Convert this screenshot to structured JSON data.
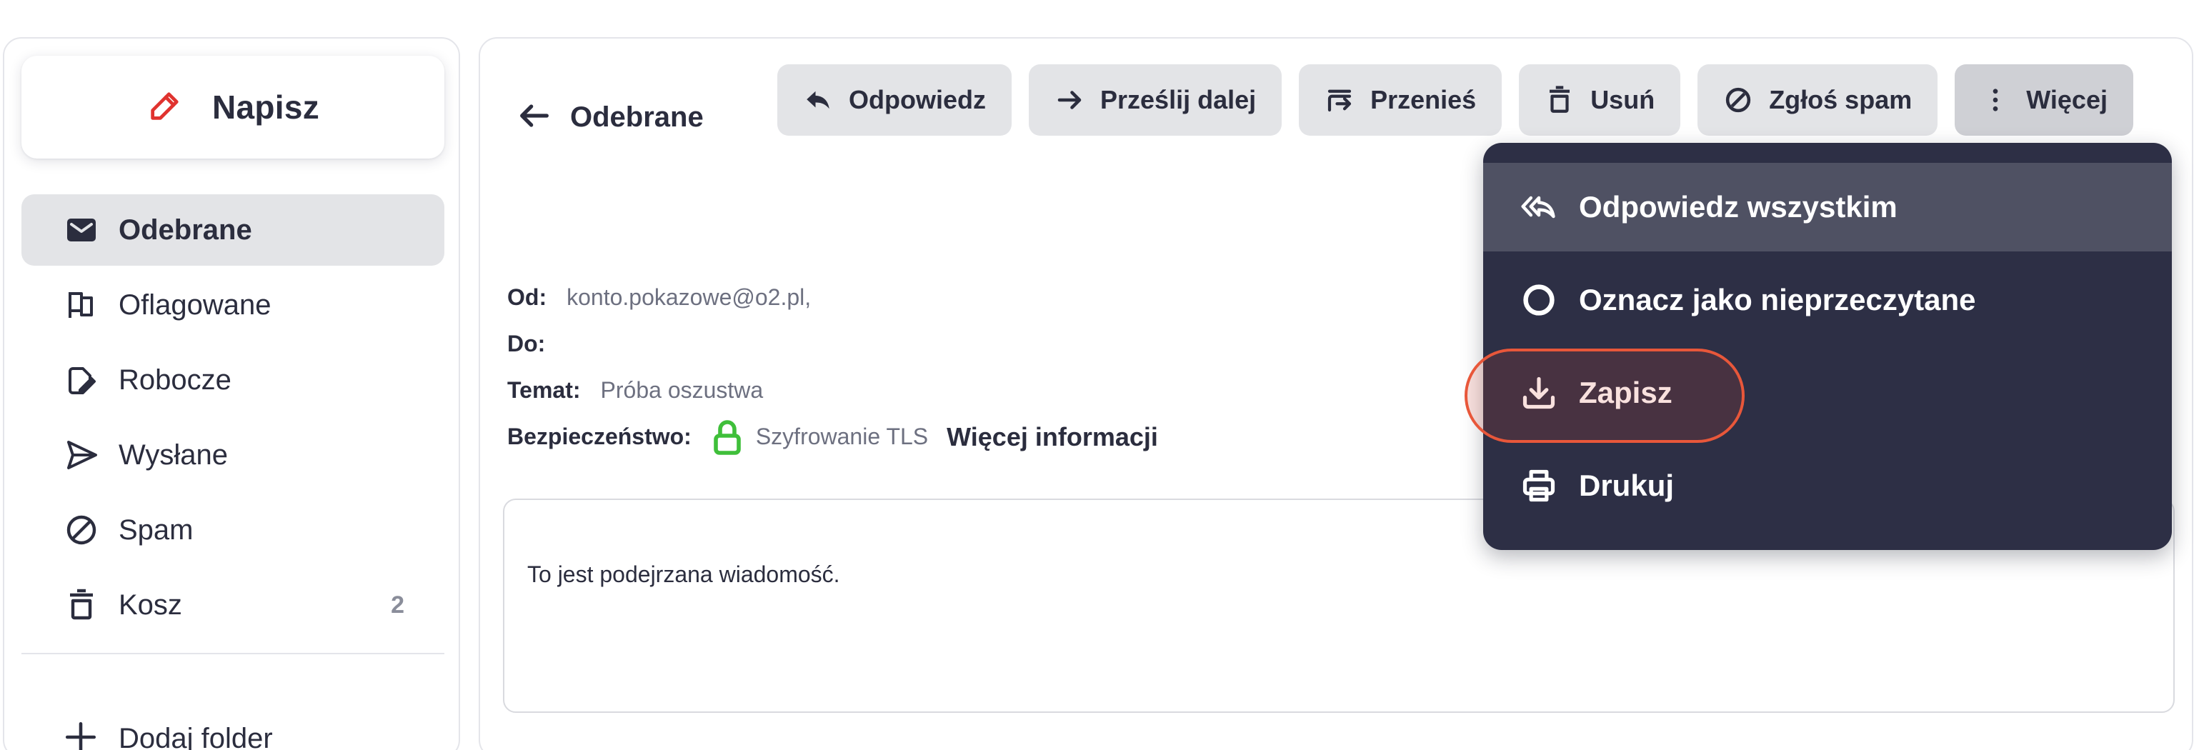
{
  "sidebar": {
    "compose_label": "Napisz",
    "folders": [
      {
        "label": "Odebrane",
        "icon": "envelope-icon",
        "active": true
      },
      {
        "label": "Oflagowane",
        "icon": "flag-icon"
      },
      {
        "label": "Robocze",
        "icon": "draft-icon"
      },
      {
        "label": "Wysłane",
        "icon": "send-icon"
      },
      {
        "label": "Spam",
        "icon": "block-icon"
      },
      {
        "label": "Kosz",
        "icon": "trash-icon",
        "count": "2"
      }
    ],
    "add_folder_label": "Dodaj folder"
  },
  "main": {
    "back_label": "Odebrane",
    "toolbar": {
      "reply": "Odpowiedz",
      "forward": "Prześlij dalej",
      "move": "Przenieś",
      "delete": "Usuń",
      "spam": "Zgłoś spam",
      "more": "Więcej"
    },
    "email": {
      "from_label": "Od:",
      "from_value": "konto.pokazowe@o2.pl,",
      "to_label": "Do:",
      "subject_label": "Temat:",
      "subject_value": "Próba oszustwa",
      "security_label": "Bezpieczeństwo:",
      "security_value": "Szyfrowanie TLS",
      "more_info": "Więcej informacji",
      "body": "To jest podejrzana wiadomość."
    }
  },
  "dropdown": {
    "items": [
      {
        "label": "Odpowiedz wszystkim",
        "icon": "reply-all-icon",
        "hovered": true
      },
      {
        "label": "Oznacz jako nieprzeczytane",
        "icon": "circle-icon"
      },
      {
        "label": "Zapisz",
        "icon": "download-icon",
        "highlighted": true
      },
      {
        "label": "Drukuj",
        "icon": "printer-icon"
      }
    ]
  },
  "colors": {
    "accent_red": "#e0332f",
    "lock_green": "#3fbf3a",
    "dropdown_bg": "#2d2f45",
    "highlight": "#e8573a"
  }
}
